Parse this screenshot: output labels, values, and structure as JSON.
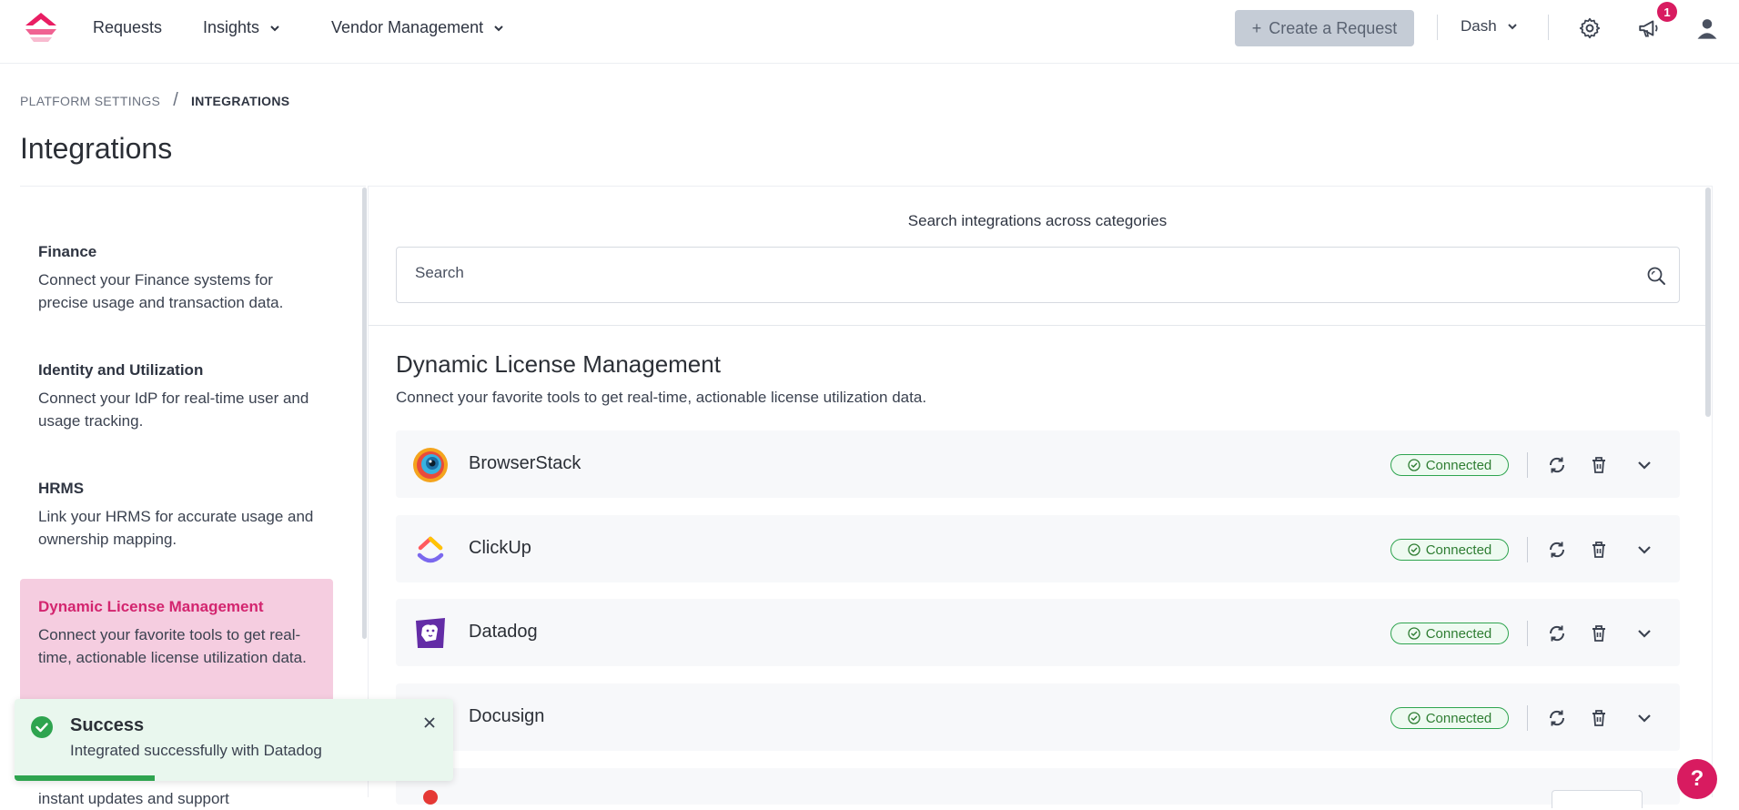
{
  "nav": {
    "requests": "Requests",
    "insights": "Insights",
    "vendor_management": "Vendor Management",
    "create_request": "Create a Request",
    "workspace": "Dash",
    "notification_count": "1"
  },
  "breadcrumb": {
    "parent": "PLATFORM SETTINGS",
    "separator": "/",
    "current": "INTEGRATIONS"
  },
  "page_title": "Integrations",
  "sidebar": {
    "items": [
      {
        "title": "Finance",
        "desc": "Connect your Finance systems for precise usage and transaction data."
      },
      {
        "title": "Identity and Utilization",
        "desc": "Connect your IdP for real-time user and usage tracking."
      },
      {
        "title": "HRMS",
        "desc": "Link your HRMS for accurate usage and ownership mapping."
      },
      {
        "title": "Dynamic License Management",
        "desc": "Connect your favorite tools to get real-time, actionable license utilization data."
      },
      {
        "title": "",
        "desc": "instant updates and support"
      }
    ]
  },
  "search": {
    "caption": "Search integrations across categories",
    "placeholder": "Search"
  },
  "section": {
    "title": "Dynamic License Management",
    "desc": "Connect your favorite tools to get real-time, actionable license utilization data."
  },
  "integrations": [
    {
      "name": "BrowserStack",
      "status": "Connected"
    },
    {
      "name": "ClickUp",
      "status": "Connected"
    },
    {
      "name": "Datadog",
      "status": "Connected"
    },
    {
      "name": "Docusign",
      "status": "Connected"
    }
  ],
  "toast": {
    "title": "Success",
    "message": "Integrated successfully with Datadog"
  },
  "help": "?",
  "colors": {
    "brand": "#d81b60",
    "connected": "#2ea44f",
    "active_bg": "#f5cde0"
  }
}
